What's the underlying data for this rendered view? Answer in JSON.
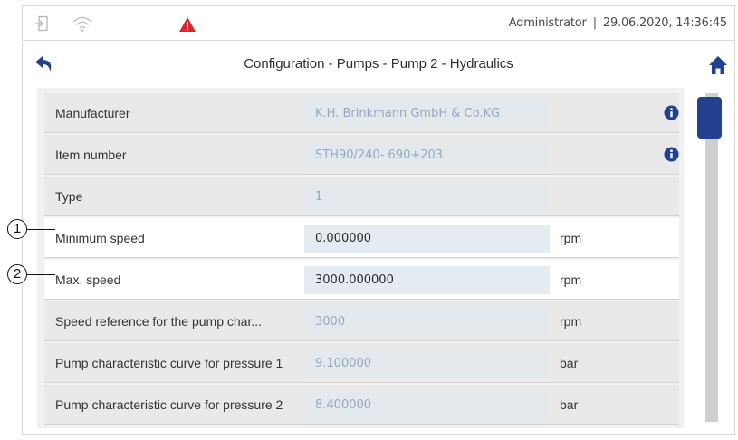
{
  "status_bar": {
    "login_icon": "login-icon",
    "wifi_icon": "wifi-icon",
    "warning_icon": "warning-triangle-icon",
    "warning_color": "#d9262b",
    "user": "Administrator",
    "separator": "|",
    "datetime": "29.06.2020, 14:36:45"
  },
  "header": {
    "title": "Configuration - Pumps - Pump 2 - Hydraulics",
    "back_icon": "back-arrow-icon",
    "home_icon": "home-icon",
    "accent_color": "#23418e"
  },
  "rows": [
    {
      "label": "Manufacturer",
      "value": "K.H. Brinkmann GmbH & Co.KG",
      "unit": "",
      "editable": false,
      "info": true
    },
    {
      "label": "Item number",
      "value": "STH90/240- 690+203",
      "unit": "",
      "editable": false,
      "info": true
    },
    {
      "label": "Type",
      "value": "1",
      "unit": "",
      "editable": false,
      "info": false
    },
    {
      "label": "Minimum speed",
      "value": "0.000000",
      "unit": "rpm",
      "editable": true,
      "info": false
    },
    {
      "label": "Max. speed",
      "value": "3000.000000",
      "unit": "rpm",
      "editable": true,
      "info": false
    },
    {
      "label": "Speed reference for the pump char...",
      "value": "3000",
      "unit": "rpm",
      "editable": false,
      "info": false
    },
    {
      "label": "Pump characteristic curve for pressure 1",
      "value": "9.100000",
      "unit": "bar",
      "editable": false,
      "info": false
    },
    {
      "label": "Pump characteristic curve for pressure 2",
      "value": "8.400000",
      "unit": "bar",
      "editable": false,
      "info": false
    }
  ],
  "callouts": [
    "1",
    "2"
  ],
  "colors": {
    "readonly_value": "#93a9c2",
    "scroll_thumb": "#23418e"
  }
}
